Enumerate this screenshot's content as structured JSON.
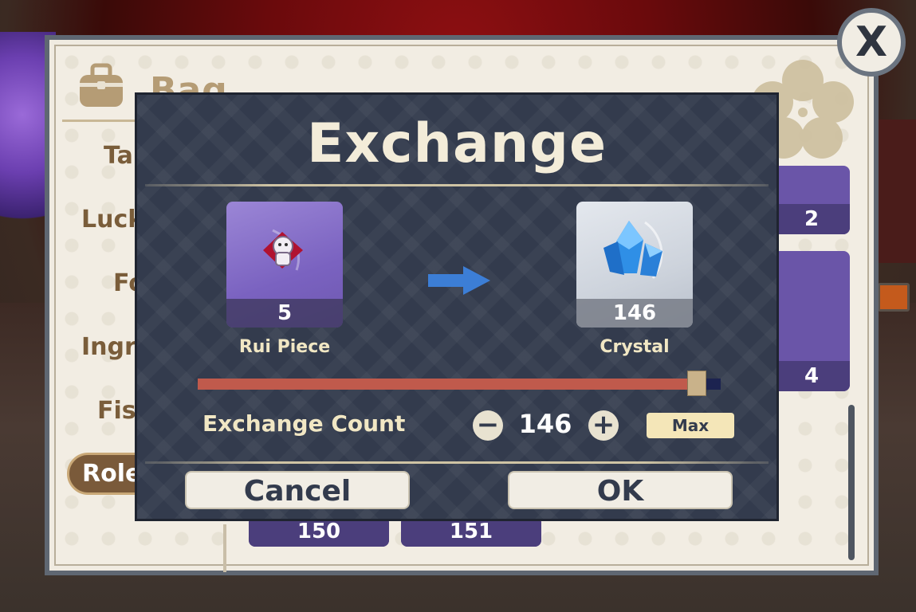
{
  "bag": {
    "title": "Bag",
    "tabs": [
      "Tale",
      "Lucky",
      "Food",
      "Ingredients",
      "Fish",
      "Roleplay"
    ],
    "active_tab": "Roleplay",
    "tiles_partial": [
      "2",
      "4",
      "150",
      "151"
    ]
  },
  "dialog": {
    "title": "Exchange",
    "from_item": {
      "name": "Rui Piece",
      "count": "5"
    },
    "to_item": {
      "name": "Crystal",
      "count": "146"
    },
    "slider_fraction": 0.97,
    "count_label": "Exchange Count",
    "count_value": "146",
    "max_label": "Max",
    "cancel_label": "Cancel",
    "ok_label": "OK"
  },
  "close_label": "X",
  "icons": [
    "bag-icon",
    "minus-icon",
    "plus-icon",
    "arrow-right-icon",
    "rui-piece-icon",
    "crystal-icon",
    "close-icon"
  ],
  "colors": {
    "dialog_bg": "#333b4d",
    "slider_fill": "#c05a4c",
    "slider_track": "#1c2350",
    "accent_text": "#f1e7c4",
    "max_button": "#f4e6b8"
  }
}
